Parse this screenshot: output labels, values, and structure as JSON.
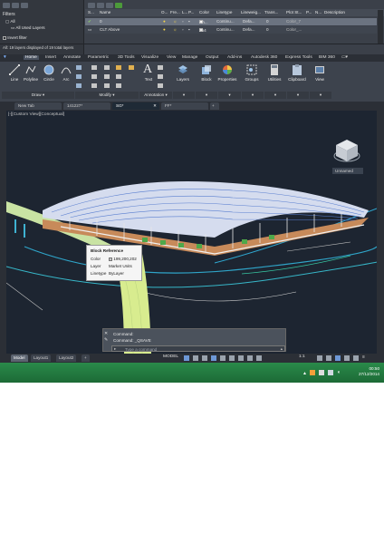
{
  "layer_manager": {
    "filters_label": "Filters",
    "tree": [
      "All",
      "All Used Layers"
    ],
    "invert_filter_label": "Invert filter",
    "status": "All: 19 layers displayed of 19 total layers",
    "columns": [
      "S...",
      "Name",
      "O...",
      "Fre...",
      "L...",
      "P...",
      "Color",
      "Linetype",
      "Lineweig...",
      "Trans...",
      "Plot St...",
      "P...",
      "N...",
      "Description"
    ],
    "rows": [
      {
        "name": "0",
        "color": "wh...",
        "linetype": "Continu...",
        "lineweight": "Defa...",
        "transparency": "0",
        "plot_style": "Color_7"
      },
      {
        "name": "CLT Above",
        "color": "254",
        "linetype": "Continu...",
        "lineweight": "Defa...",
        "transparency": "0",
        "plot_style": "Color_..."
      }
    ]
  },
  "ribbon": {
    "tabs": [
      "Home",
      "Insert",
      "Annotate",
      "Parametric",
      "3D Tools",
      "Visualize",
      "View",
      "Manage",
      "Output",
      "Add-ins",
      "Autodesk 360",
      "Express Tools",
      "BIM 360"
    ],
    "active_tab": "Home",
    "draw_buttons": [
      "Line",
      "Polyline",
      "Circle",
      "Arc"
    ],
    "text_button": "Text",
    "big_buttons": [
      "Layers",
      "Block",
      "Properties",
      "Groups",
      "Utilities",
      "Clipboard",
      "View"
    ],
    "panels": [
      "Draw",
      "Modify",
      "Annotation"
    ]
  },
  "doc_tabs": [
    "New Tab",
    "141227*",
    "SG*",
    "FF*"
  ],
  "active_doc": "SG*",
  "viewport_label": "[-][Custom View][Conceptual]",
  "viewcube_label": "Unnamed",
  "tooltip": {
    "title": "Block Reference",
    "rows": [
      {
        "k": "Color",
        "v": "199,200,202"
      },
      {
        "k": "Layer",
        "v": "Market Units"
      },
      {
        "k": "Linetype",
        "v": "ByLayer"
      }
    ]
  },
  "command": {
    "history": [
      "Command:",
      "Command:  _QSAVE"
    ],
    "placeholder": "Type a command"
  },
  "layout_tabs": [
    "Model",
    "Layout1",
    "Layout2"
  ],
  "status_model": "MODEL",
  "status_scale": "1:1",
  "clock": {
    "time": "00:50",
    "date": "27/12/2014"
  },
  "colors": {
    "accent": "#4a5260",
    "viewport_bg": "#1d2531",
    "taskbar": "#1f7a3e"
  }
}
